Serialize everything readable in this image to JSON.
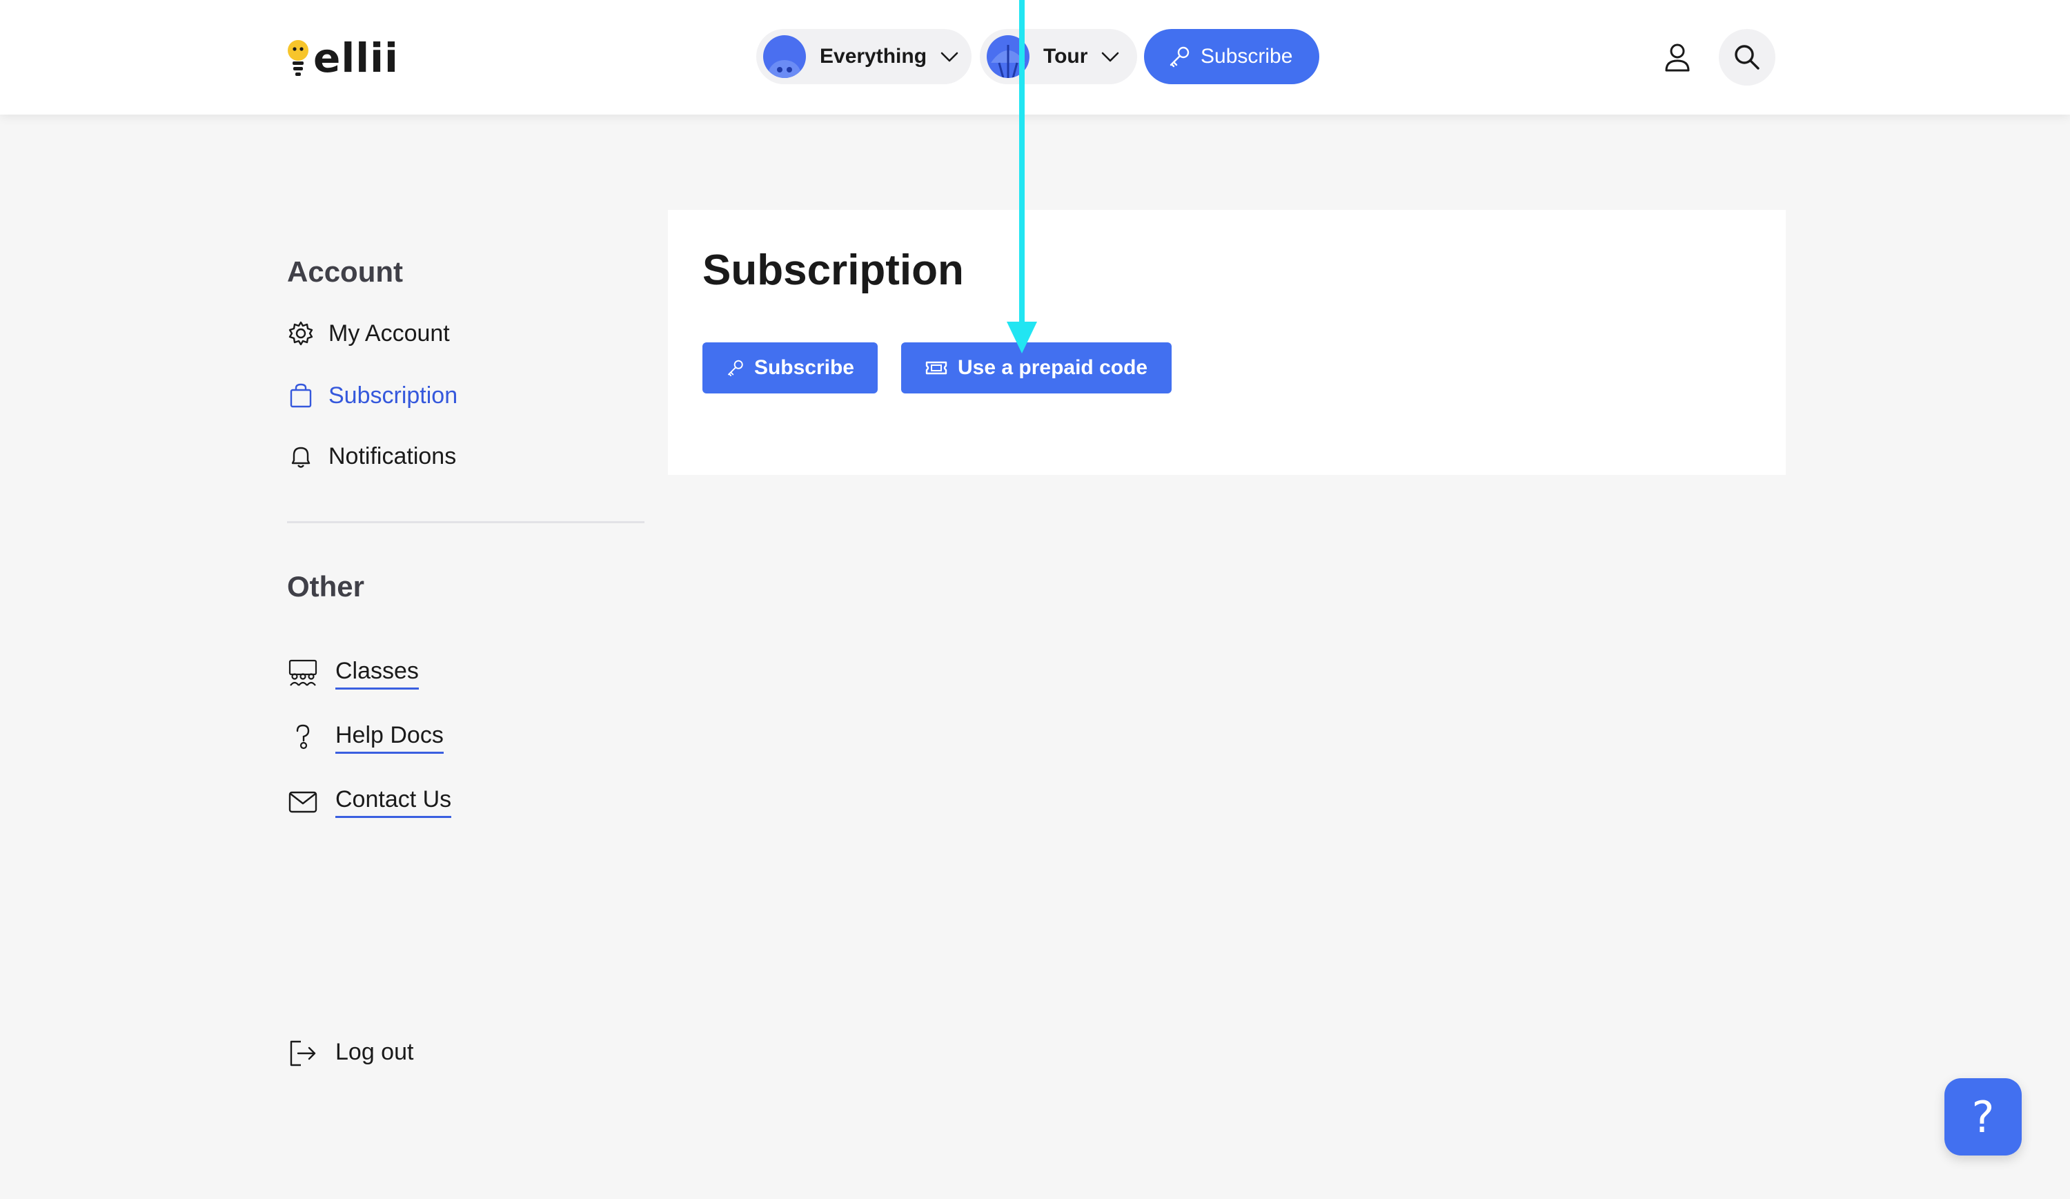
{
  "brand": {
    "name": "ellii"
  },
  "header": {
    "everything_label": "Everything",
    "tour_label": "Tour",
    "subscribe_label": "Subscribe"
  },
  "sidebar": {
    "account_heading": "Account",
    "account_items": [
      {
        "label": "My Account",
        "icon": "gear-icon"
      },
      {
        "label": "Subscription",
        "icon": "bag-icon",
        "active": true
      },
      {
        "label": "Notifications",
        "icon": "bell-icon"
      }
    ],
    "other_heading": "Other",
    "other_items": [
      {
        "label": "Classes",
        "icon": "classroom-icon"
      },
      {
        "label": "Help Docs",
        "icon": "question-icon"
      },
      {
        "label": "Contact Us",
        "icon": "mail-icon"
      }
    ],
    "logout_label": "Log out"
  },
  "main": {
    "title": "Subscription",
    "subscribe_button": "Subscribe",
    "prepaid_button": "Use a prepaid code"
  },
  "help": {
    "glyph": "?"
  },
  "colors": {
    "accent": "#4270f0",
    "active_link": "#3558dc",
    "annotation": "#22e5f2",
    "page_bg": "#f6f6f6"
  }
}
